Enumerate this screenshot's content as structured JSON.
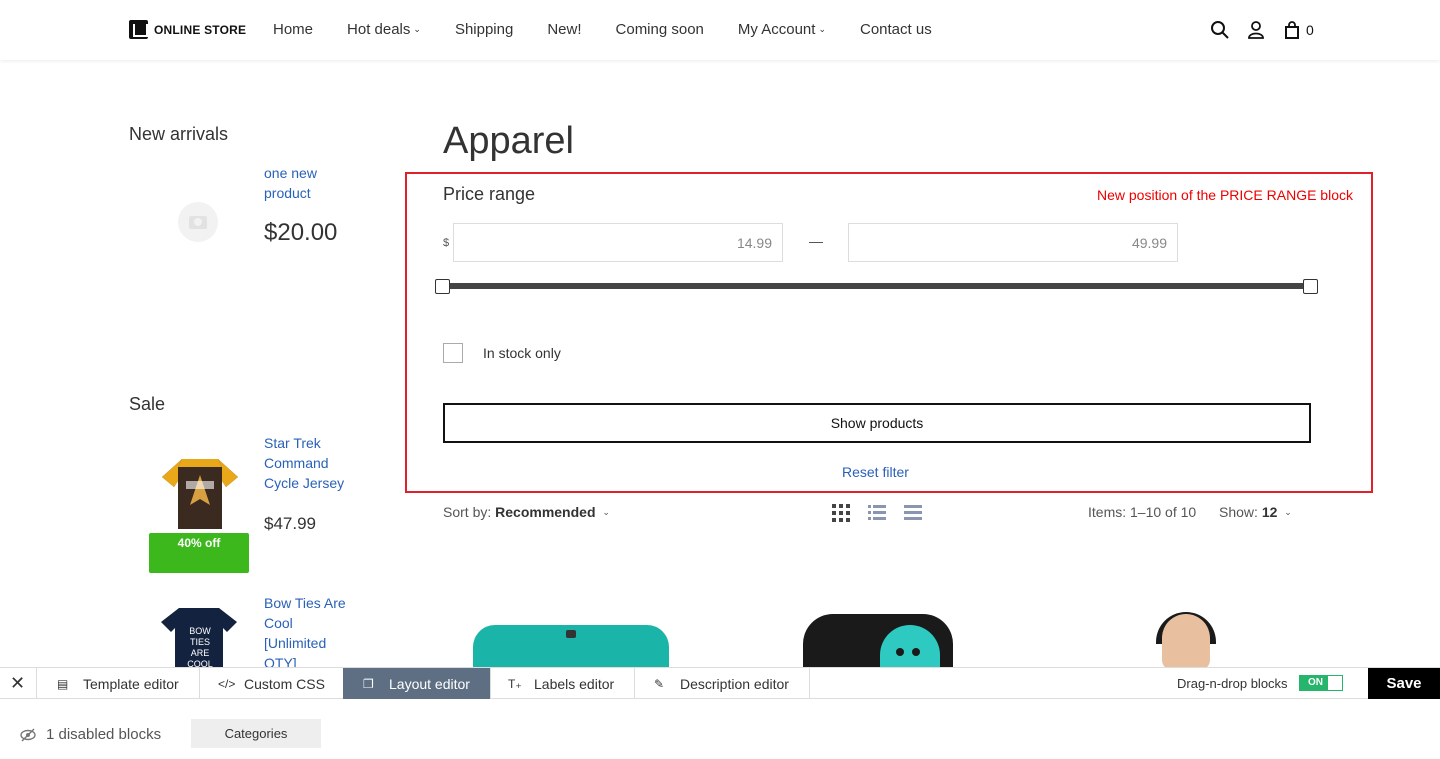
{
  "header": {
    "logo_text": "ONLINE STORE",
    "nav": [
      "Home",
      "Hot deals",
      "Shipping",
      "New!",
      "Coming soon",
      "My Account",
      "Contact us"
    ],
    "cart_count": "0"
  },
  "sidebar": {
    "new_arrivals_title": "New arrivals",
    "new_product": {
      "name": "one new product",
      "price": "$20.00"
    },
    "sale_title": "Sale",
    "sale_items": [
      {
        "name": "Star Trek Command Cycle Jersey",
        "price": "$47.99",
        "badge": "40% off"
      },
      {
        "name": "Bow Ties Are Cool [Unlimited QTY]",
        "tee_text": "BOW TIES ARE COOL"
      }
    ]
  },
  "main": {
    "title": "Apparel",
    "filter": {
      "title": "Price range",
      "note": "New position of the PRICE RANGE block",
      "currency": "$",
      "min": "14.99",
      "max": "49.99",
      "in_stock_label": "In stock only",
      "show_button": "Show products",
      "reset_link": "Reset filter"
    },
    "sort": {
      "label": "Sort by:",
      "value": "Recommended",
      "items": "Items: 1–10 of 10",
      "show_label": "Show:",
      "show_value": "12"
    }
  },
  "toolbar": {
    "items": [
      "Template editor",
      "Custom CSS",
      "Layout editor",
      "Labels editor",
      "Description editor"
    ],
    "active": "Layout editor",
    "toggle_label": "Drag-n-drop blocks",
    "toggle_state": "ON",
    "save": "Save"
  },
  "bottom": {
    "disabled_blocks": "1 disabled blocks",
    "category_button": "Categories"
  },
  "colors": {
    "link": "#2a61b8",
    "badge": "#3cb81d",
    "highlight": "#e0202a",
    "toggle": "#27b46c"
  }
}
